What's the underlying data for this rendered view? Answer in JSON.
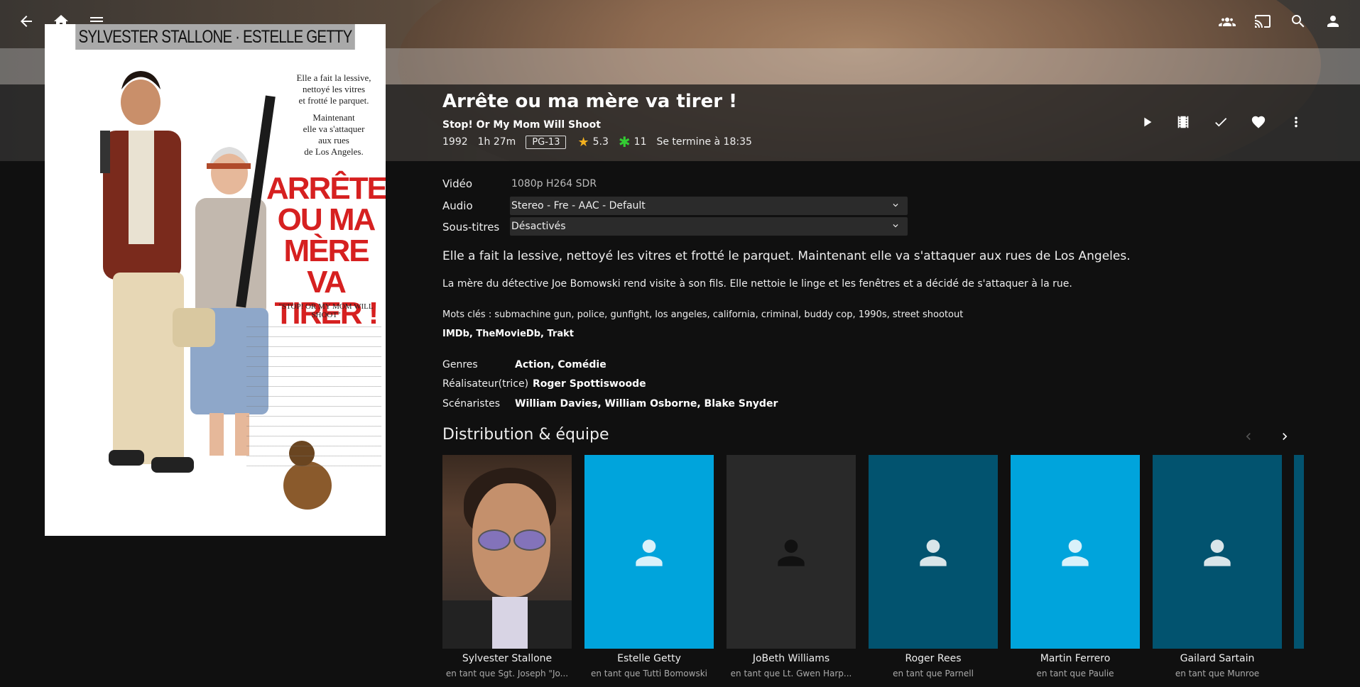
{
  "colors": {
    "accent": "#00a4dc",
    "dark_teal": "#02536f",
    "card_grey": "#292929",
    "star": "#f2b01e",
    "green": "#33cc33"
  },
  "topbar": {
    "icons_left": [
      "back-arrow-icon",
      "home-icon",
      "menu-icon"
    ],
    "icons_right": [
      "users-icon",
      "cast-icon",
      "search-icon",
      "user-icon"
    ]
  },
  "poster": {
    "caption": "SYLVESTER STALLONE · ESTELLE GETTY",
    "tagline_lines": [
      "Elle a fait la lessive,",
      "nettoyé les vitres",
      "et frotté le parquet.",
      "",
      "Maintenant",
      "elle va s'attaquer",
      "aux rues",
      "de Los Angeles."
    ],
    "big_title": "ARRÊTE OU MA MÈRE VA TIRER !",
    "small_title": "\"STOP! OR MY MOM WILL SHOOT\""
  },
  "item": {
    "title": "Arrête ou ma mère va tirer !",
    "original_title": "Stop! Or My Mom Will Shoot",
    "year": "1992",
    "runtime": "1h 27m",
    "rating": "PG-13",
    "community_rating": "5.3",
    "critic_rating": "11",
    "ends_at": "Se termine à 18:35"
  },
  "actions": [
    "play-icon",
    "trailer-icon",
    "played-check-icon",
    "favorite-heart-icon",
    "more-vertical-icon"
  ],
  "media": {
    "video_label": "Vidéo",
    "video_value": "1080p H264 SDR",
    "audio_label": "Audio",
    "audio_value": "Stereo - Fre - AAC - Default",
    "subs_label": "Sous-titres",
    "subs_value": "Désactivés"
  },
  "tagline": "Elle a fait la lessive, nettoyé les vitres et frotté le parquet. Maintenant elle va s'attaquer aux rues de Los Angeles.",
  "overview": "La mère du détective Joe Bomowski rend visite à son fils. Elle nettoie le linge et les fenêtres et a décidé de s'attaquer à la rue.",
  "keywords": "Mots clés : submachine gun, police, gunfight, los angeles, california, criminal, buddy cop, 1990s, street shootout",
  "links": [
    "IMDb",
    "TheMovieDb",
    "Trakt"
  ],
  "details": {
    "genres_label": "Genres",
    "genres_value": "Action, Comédie",
    "director_label": "Réalisateur(trice)",
    "director_value": "Roger Spottiswoode",
    "writers_label": "Scénaristes",
    "writers_value": "William Davies, William Osborne, Blake Snyder"
  },
  "cast_section": {
    "title": "Distribution & équipe"
  },
  "cast": [
    {
      "name": "Sylvester Stallone",
      "role": "en tant que Sgt. Joseph \"Jo...",
      "style": "photo"
    },
    {
      "name": "Estelle Getty",
      "role": "en tant que Tutti Bomowski",
      "style": "blue"
    },
    {
      "name": "JoBeth Williams",
      "role": "en tant que Lt. Gwen Harp...",
      "style": "grey"
    },
    {
      "name": "Roger Rees",
      "role": "en tant que Parnell",
      "style": "teal"
    },
    {
      "name": "Martin Ferrero",
      "role": "en tant que Paulie",
      "style": "blue"
    },
    {
      "name": "Gailard Sartain",
      "role": "en tant que Munroe",
      "style": "teal"
    }
  ]
}
